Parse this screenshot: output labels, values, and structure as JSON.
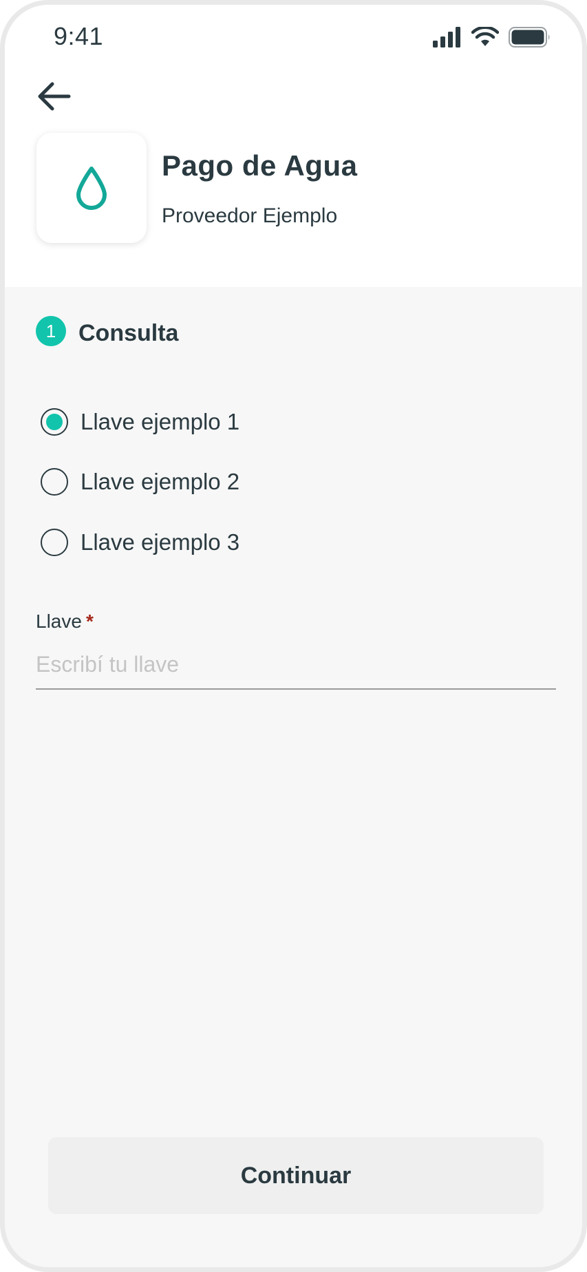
{
  "status_bar": {
    "time": "9:41",
    "icons": [
      "signal-icon",
      "wifi-icon",
      "battery-icon"
    ]
  },
  "header": {
    "back_icon": "arrow-left-icon",
    "logo_icon": "water-drop-icon",
    "title": "Pago de Agua",
    "subtitle": "Proveedor Ejemplo"
  },
  "step": {
    "number": "1",
    "title": "Consulta"
  },
  "key_options": [
    {
      "label": "Llave ejemplo 1",
      "selected": true
    },
    {
      "label": "Llave ejemplo 2",
      "selected": false
    },
    {
      "label": "Llave ejemplo 3",
      "selected": false
    }
  ],
  "field": {
    "label": "Llave",
    "required_mark": "*",
    "value": "",
    "placeholder": "Escribí tu llave"
  },
  "actions": {
    "continue_label": "Continuar"
  },
  "colors": {
    "accent": "#12c4ac",
    "text": "#2a3a40",
    "required": "#a5281c",
    "background": "#f7f7f7"
  }
}
